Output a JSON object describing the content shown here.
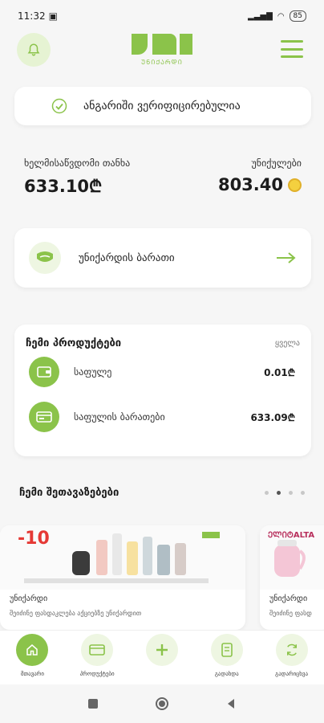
{
  "status_bar": {
    "time": "11:32",
    "battery": "85"
  },
  "header": {
    "logo_tag": "ᲣᲜᲘᲥᲐᲠᲓᲘ"
  },
  "verified_banner": {
    "text": "ანგარიში ვერიფიცირებულია"
  },
  "balances": {
    "available_label": "ხელმისაწვდომი თანხა",
    "available_value": "633.10₾",
    "points_label": "უნიქულები",
    "points_value": "803.40"
  },
  "unicard_row": {
    "label": "უნიქარდის ბარათი"
  },
  "products": {
    "title": "ჩემი პროდუქტები",
    "all_label": "ყველა",
    "items": [
      {
        "name": "საფულე",
        "amount": "0.01₾"
      },
      {
        "name": "საფულის ბარათები",
        "amount": "633.09₾"
      }
    ]
  },
  "offers": {
    "title": "ჩემი შეთავაზებები",
    "cards": [
      {
        "sale": "-10",
        "name": "უნიქარდი",
        "desc": "შეიძინე ფასდაკლება აქციებზე უნიქარდით"
      },
      {
        "brand_prefix": "ᲔᲚᲘᲢ",
        "brand": "ALTA",
        "name": "უნიქარდი",
        "desc": "შეიძინე ფასდ"
      }
    ]
  },
  "bottom_nav": [
    {
      "label": "მთავარი"
    },
    {
      "label": "პროდუქტები"
    },
    {
      "label": ""
    },
    {
      "label": "გადახდა"
    },
    {
      "label": "გადარიცხვა"
    }
  ],
  "colors": {
    "accent": "#8bc34a",
    "accent_light": "#eef6e2",
    "sale": "#e53935"
  }
}
